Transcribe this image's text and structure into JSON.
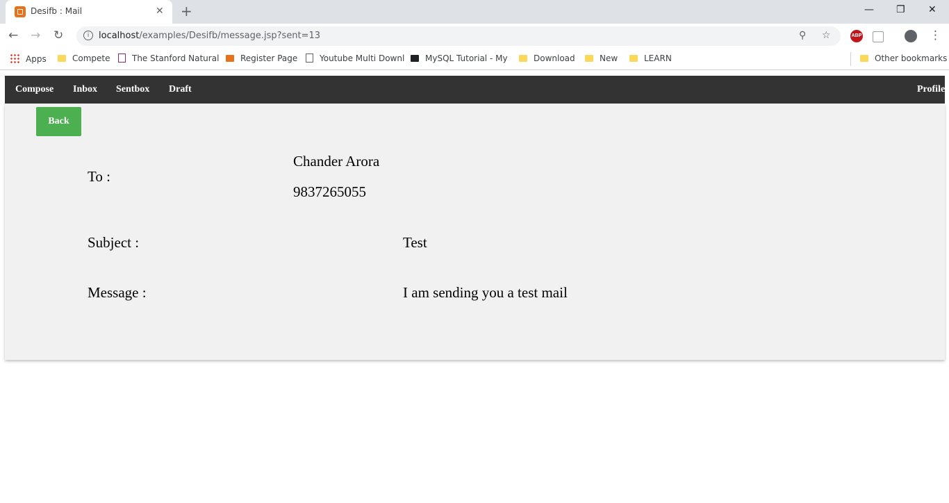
{
  "browser": {
    "tab_title": "Desifb : Mail",
    "tab_close": "✕",
    "new_tab": "+",
    "window_controls": {
      "minimize": "—",
      "restore": "❐",
      "close": "✕"
    },
    "url_host": "localhost",
    "url_path": "/examples/Desifb/message.jsp?sent=13",
    "icons": {
      "back": "←",
      "forward": "→",
      "reload": "↻",
      "info": "i",
      "zoom": "⚲",
      "star": "☆",
      "menu": "⋮"
    },
    "extensions": {
      "abp": "ABP"
    },
    "bookmarks": [
      {
        "label": "Apps",
        "icon": "apps-grid-icon"
      },
      {
        "label": "Compete",
        "icon": "folder-icon"
      },
      {
        "label": "The Stanford Natural",
        "icon": "nlp-icon"
      },
      {
        "label": "Register Page",
        "icon": "xampp-icon"
      },
      {
        "label": "Youtube Multi Downl",
        "icon": "page-icon"
      },
      {
        "label": "MySQL Tutorial - My",
        "icon": "terminal-icon"
      },
      {
        "label": "Download",
        "icon": "folder-icon"
      },
      {
        "label": "New",
        "icon": "folder-icon"
      },
      {
        "label": "LEARN",
        "icon": "folder-icon"
      }
    ],
    "other_bookmarks": "Other bookmarks"
  },
  "nav": {
    "compose": "Compose",
    "inbox": "Inbox",
    "sentbox": "Sentbox",
    "draft": "Draft",
    "profile": "Profile"
  },
  "message": {
    "back_label": "Back",
    "to_label": "To :",
    "to_name": "Chander Arora",
    "to_phone": "9837265055",
    "subject_label": "Subject :",
    "subject_value": "Test",
    "message_label": "Message :",
    "message_value": "I am sending you a test mail"
  },
  "colors": {
    "navbar": "#333333",
    "back_button": "#4caf50",
    "card": "#f1f1f1",
    "favicon": "#e8721c"
  }
}
